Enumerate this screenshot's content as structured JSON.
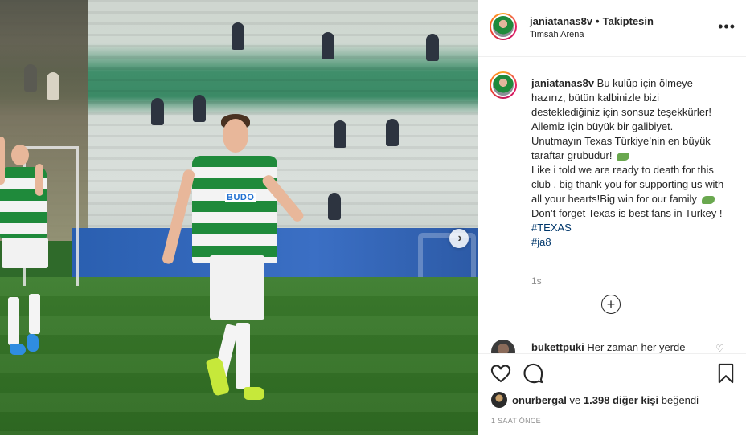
{
  "header": {
    "username": "janiatanas8v",
    "separator": "•",
    "follow_status": "Takiptesin",
    "location": "Timsah Arena",
    "more_icon": "more-options-icon"
  },
  "photo": {
    "sponsor_text": "BUDO",
    "next_icon": "chevron-right-icon"
  },
  "caption": {
    "username": "janiatanas8v",
    "line_tr_1": "Bu kulüp için ölmeye hazırız, bütün kalbinizle bizi desteklediğiniz için sonsuz teşekkürler! Ailemiz için büyük bir galibiyet. Unutmayın Texas Türkiye’nin en büyük taraftar grubudur!",
    "line_en_1": "Like i told we are ready to death for this club , big thank you for supporting us with all your hearts!Big win for our family",
    "line_en_2": "Don’t forget Texas is best fans in Turkey !",
    "hashtag_1": "#TEXAS",
    "hashtag_2": "#ja8",
    "emoji_icon": "crocodile-emoji-icon",
    "time_ago": "1s",
    "load_more_icon": "plus-circle-icon"
  },
  "comment": {
    "username": "bukettpuki",
    "text": "Her zaman her yerde"
  },
  "actions": {
    "like_icon": "heart-icon",
    "comment_icon": "comment-bubble-icon",
    "save_icon": "bookmark-icon",
    "liked_by_user": "onurbergal",
    "liked_by_connector": "ve",
    "liked_by_others": "1.398 diğer kişi",
    "liked_by_suffix": "beğendi",
    "timestamp": "1 SAAT ÖNCE"
  }
}
